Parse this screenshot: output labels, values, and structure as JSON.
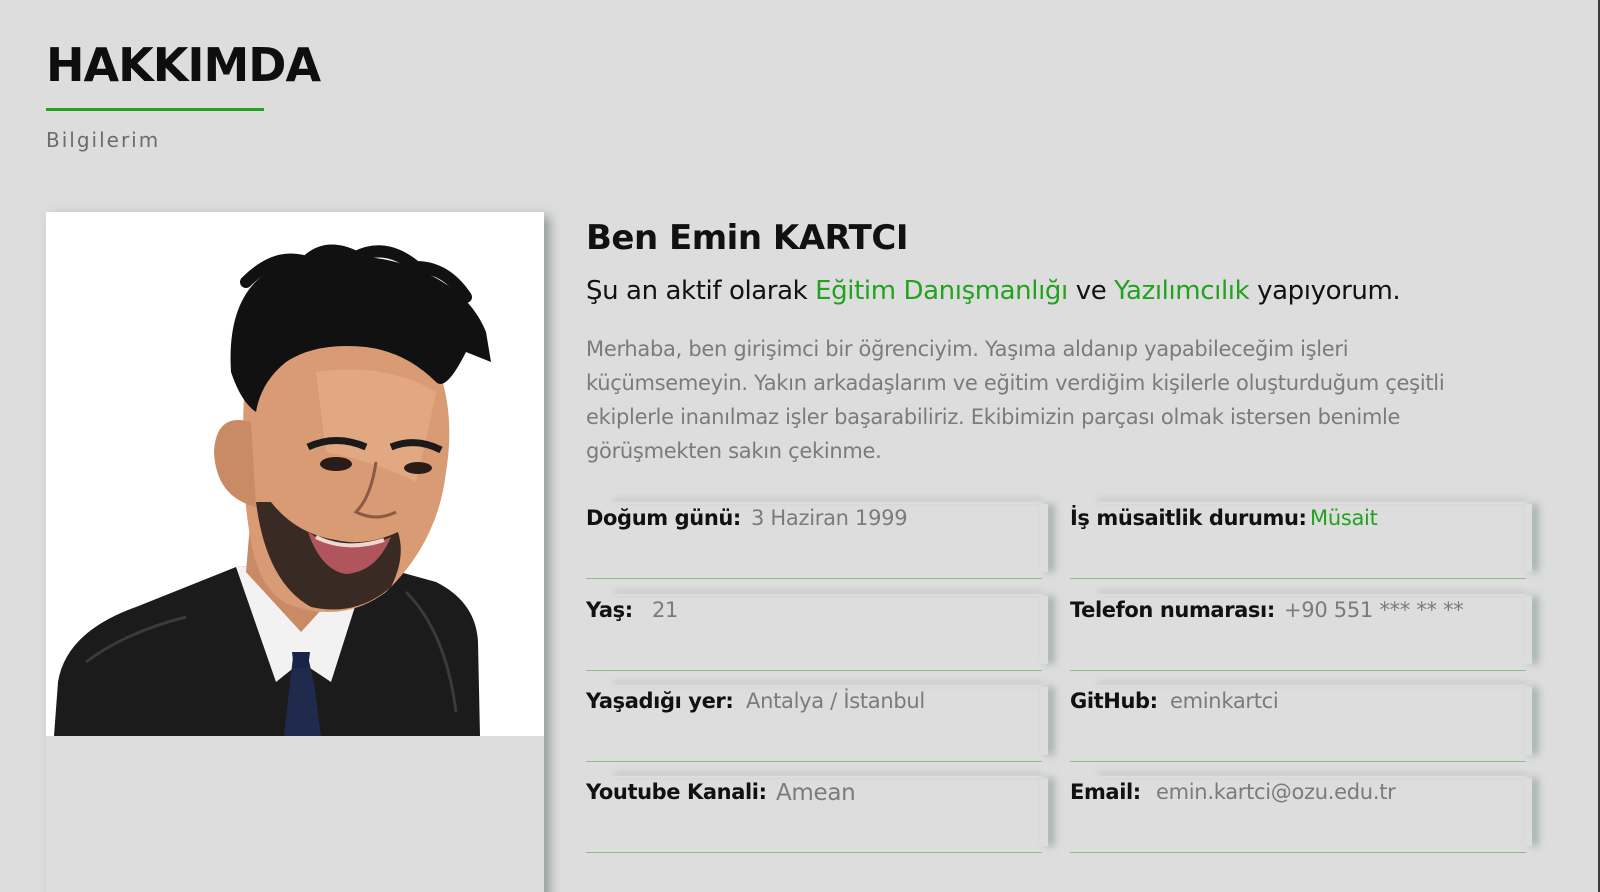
{
  "section": {
    "title": "HAKKIMDA",
    "subtitle": "Bilgilerim"
  },
  "profile": {
    "name": "Ben Emin KARTCI",
    "tagline": {
      "prefix": "Şu an aktif olarak ",
      "highlight1": "Eğitim Danışmanlığı",
      "middle": " ve ",
      "highlight2": "Yazılımcılık",
      "suffix": " yapıyorum."
    },
    "bio": "Merhaba, ben girişimci bir öğrenciyim. Yaşıma aldanıp yapabileceğim işleri küçümsemeyin. Yakın arkadaşlarım ve eğitim verdiğim kişilerle oluşturduğum çeşitli ekiplerle inanılmaz işler başarabiliriz. Ekibimizin parçası olmak istersen benimle görüşmekten sakın çekinme."
  },
  "fields": [
    {
      "label": "Doğum günü:",
      "value": "3 Haziran 1999"
    },
    {
      "label": "İş müsaitlik durumu:",
      "value": "Müsait"
    },
    {
      "label": "Yaş:",
      "value": "21"
    },
    {
      "label": "Telefon numarası:",
      "value": "+90 551 *** ** **"
    },
    {
      "label": "Yaşadığı yer:",
      "value": "Antalya / İstanbul"
    },
    {
      "label": "GitHub:",
      "value": "eminkartci"
    },
    {
      "label": "Youtube Kanali:",
      "value": "Amean"
    },
    {
      "label": "Email:",
      "value": "emin.kartci@ozu.edu.tr"
    }
  ],
  "colors": {
    "accent": "#22a31f",
    "background": "#dddddd",
    "muted_text": "#7b7b7b"
  }
}
